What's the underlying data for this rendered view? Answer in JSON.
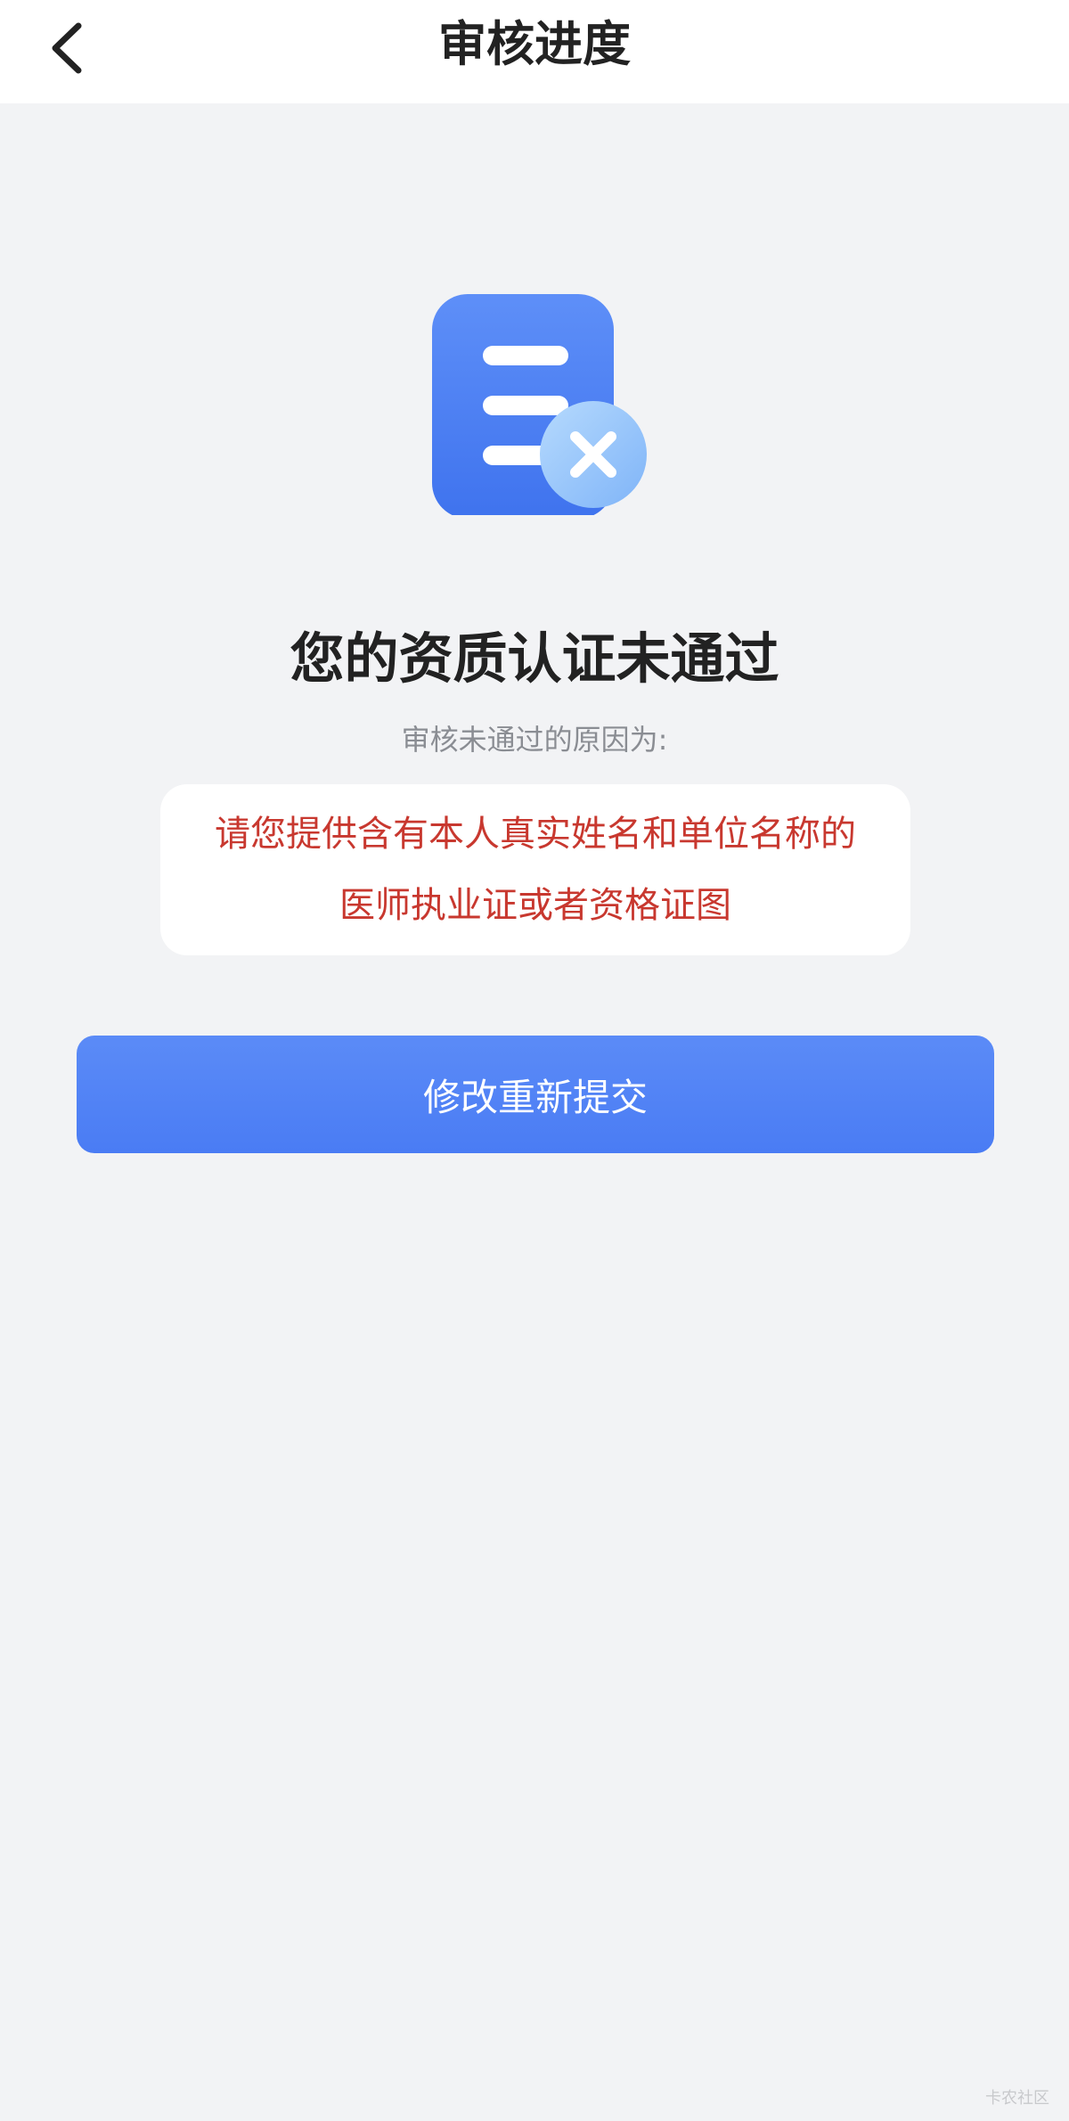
{
  "nav": {
    "title": "审核进度",
    "back_icon": "chevron-left-icon"
  },
  "status": {
    "icon": "document-rejected-icon",
    "title": "您的资质认证未通过",
    "reason_label": "审核未通过的原因为:",
    "reason_text": "请您提供含有本人真实姓名和单位名称的医师执业证或者资格证图"
  },
  "actions": {
    "resubmit_label": "修改重新提交"
  },
  "watermark": {
    "text": "卡农社区"
  },
  "colors": {
    "primary": "#4a7cf4",
    "error_text": "#c8382f",
    "background": "#f2f3f5"
  }
}
